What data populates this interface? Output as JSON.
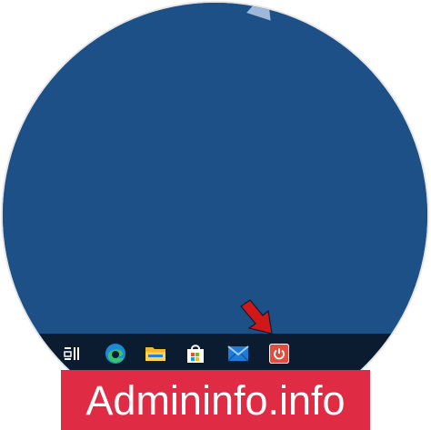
{
  "taskbar": {
    "icons": [
      "task-view-icon",
      "edge-icon",
      "file-explorer-icon",
      "store-icon",
      "mail-icon",
      "shutdown-icon"
    ]
  },
  "colors": {
    "desktop": "#1d5087",
    "taskbar": "#0b1c30",
    "banner": "#e02b45",
    "arrow": "#d01818",
    "shutdown": "#e34b3c"
  },
  "watermark": {
    "text": "Admininfo.info"
  }
}
